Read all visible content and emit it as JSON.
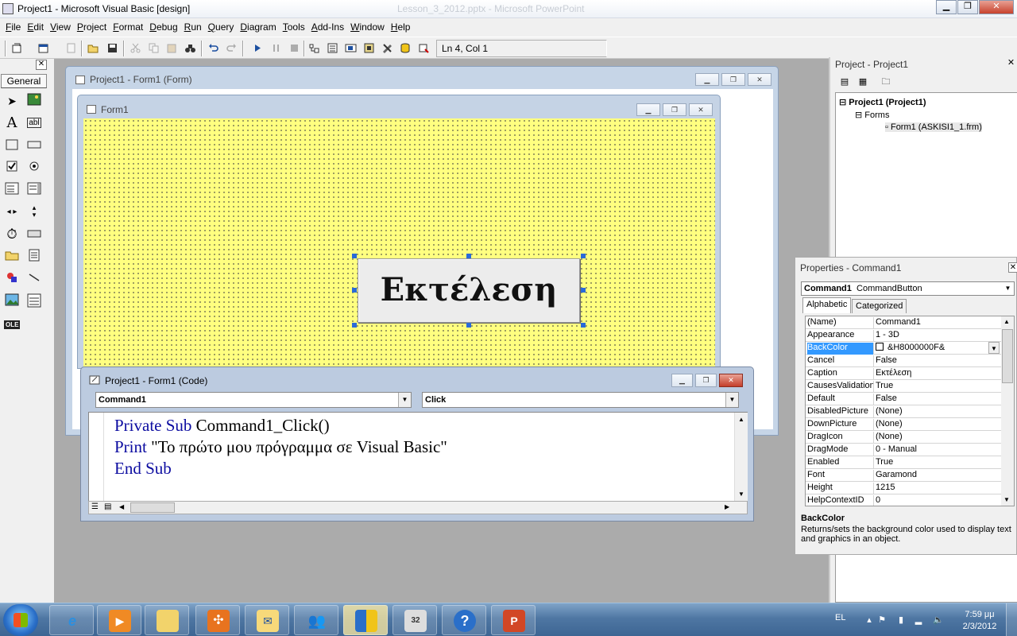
{
  "window": {
    "title": "Project1 - Microsoft Visual Basic [design]",
    "ghost_title": "Lesson_3_2012.pptx - Microsoft PowerPoint"
  },
  "menu": [
    "File",
    "Edit",
    "View",
    "Project",
    "Format",
    "Debug",
    "Run",
    "Query",
    "Diagram",
    "Tools",
    "Add-Ins",
    "Window",
    "Help"
  ],
  "toolbar": {
    "position": "Ln 4, Col 1"
  },
  "toolbox": {
    "tab": "General"
  },
  "designer": {
    "title": "Project1 - Form1 (Form)"
  },
  "form1": {
    "title": "Form1",
    "backcolor": "#ffff80",
    "button_caption": "Εκτέλεση"
  },
  "code_window": {
    "title": "Project1 - Form1 (Code)",
    "object_combo": "Command1",
    "proc_combo": "Click",
    "lines": [
      {
        "kw": "Private Sub",
        "rest": " Command1_Click()"
      },
      {
        "kw": "Print",
        "rest": " \"Το πρώτο μου πρόγραμμα σε Visual Basic\""
      },
      {
        "kw": "End Sub",
        "rest": ""
      }
    ]
  },
  "project_explorer": {
    "title": "Project - Project1",
    "tree": {
      "project": "Project1 (Project1)",
      "folder": "Forms",
      "form": "Form1 (ASKISI1_1.frm)"
    }
  },
  "properties": {
    "title": "Properties - Command1",
    "object_name": "Command1",
    "object_type": "CommandButton",
    "tabs": [
      "Alphabetic",
      "Categorized"
    ],
    "rows": [
      {
        "name": "(Name)",
        "value": "Command1"
      },
      {
        "name": "Appearance",
        "value": "1 - 3D"
      },
      {
        "name": "BackColor",
        "value": "&H8000000F&"
      },
      {
        "name": "Cancel",
        "value": "False"
      },
      {
        "name": "Caption",
        "value": "Εκτέλεση"
      },
      {
        "name": "CausesValidation",
        "value": "True"
      },
      {
        "name": "Default",
        "value": "False"
      },
      {
        "name": "DisabledPicture",
        "value": "(None)"
      },
      {
        "name": "DownPicture",
        "value": "(None)"
      },
      {
        "name": "DragIcon",
        "value": "(None)"
      },
      {
        "name": "DragMode",
        "value": "0 - Manual"
      },
      {
        "name": "Enabled",
        "value": "True"
      },
      {
        "name": "Font",
        "value": "Garamond"
      },
      {
        "name": "Height",
        "value": "1215"
      },
      {
        "name": "HelpContextID",
        "value": "0"
      }
    ],
    "desc_title": "BackColor",
    "desc_text": "Returns/sets the background color used to display text and graphics in an object."
  },
  "taskbar": {
    "lang": "EL",
    "time": "7:59 μμ",
    "date": "2/3/2012"
  }
}
